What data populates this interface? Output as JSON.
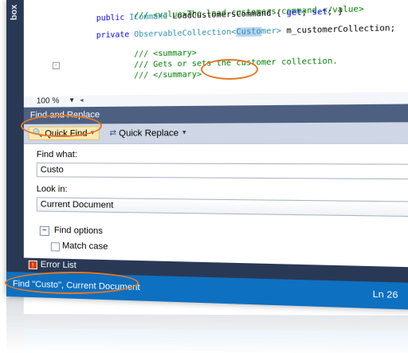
{
  "toolbox_label": "box",
  "editor": {
    "lines": [
      {
        "comment": "/// <value>The load customers command.</value>"
      },
      {
        "kw": "public",
        "type": "ICommand",
        "rest": " LoadCustomersCommand { ",
        "kw2": "get",
        "sep": "; ",
        "kw3": "set",
        "end": "; }"
      },
      {
        "kw": "private",
        "type": "ObservableCollection<",
        "hl": "Custo",
        "type2": "mer>",
        "rest": " m_customerCollection;"
      },
      {
        "comment": "/// <summary>"
      },
      {
        "comment": "/// Gets or sets the customer collection."
      },
      {
        "comment": "/// </summary>"
      }
    ],
    "zoom": "100 %"
  },
  "find_panel": {
    "title": "Find and Replace",
    "quick_find_label": "Quick Find",
    "quick_replace_label": "Quick Replace",
    "find_what_label": "Find what:",
    "find_what_value": "Custo",
    "look_in_label": "Look in:",
    "look_in_value": "Current Document",
    "find_options_label": "Find options",
    "match_case_label": "Match case"
  },
  "tab_strip": {
    "error_list_label": "Error List"
  },
  "status_bar": {
    "text": "Find \"Custo\", Current Document",
    "line": "Ln 26"
  },
  "colors": {
    "accent_orange": "#e87722",
    "status_blue": "#0e70c0",
    "panel_title": "#4d6082"
  }
}
